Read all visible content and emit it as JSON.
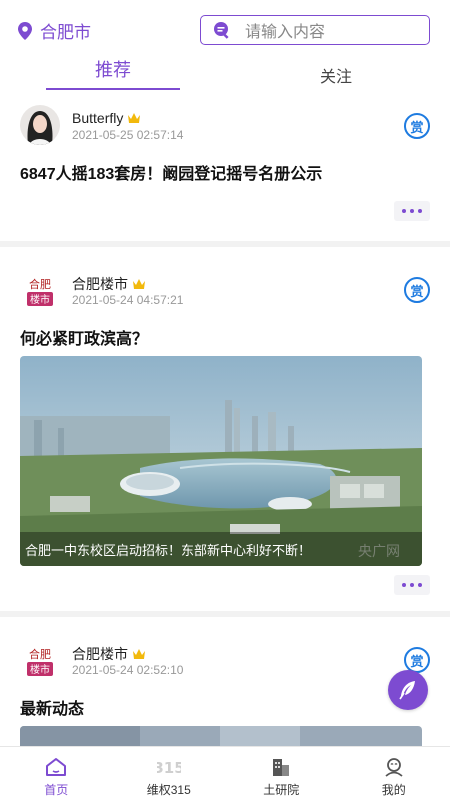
{
  "header": {
    "city": "合肥市",
    "search_placeholder": "请输入内容"
  },
  "tabs": [
    {
      "label": "推荐",
      "active": true
    },
    {
      "label": "关注",
      "active": false
    }
  ],
  "posts": [
    {
      "author": "Butterfly",
      "time": "2021-05-25 02:57:14",
      "title": "6847人摇183套房！阚园登记摇号名册公示",
      "reward": "赏"
    },
    {
      "author": "合肥楼市",
      "avatar_text": "合肥楼市",
      "time": "2021-05-24 04:57:21",
      "title": "何必紧盯政滨高？",
      "reward": "赏",
      "image_caption": "合肥一中东校区启动招标！东部新中心利好不断！",
      "watermark": "央广网"
    },
    {
      "author": "合肥楼市",
      "avatar_text": "合肥楼市",
      "time": "2021-05-24 02:52:10",
      "title": "最新动态",
      "reward": "赏"
    }
  ],
  "nav": [
    {
      "label": "首页",
      "icon": "home-icon",
      "active": true
    },
    {
      "label": "维权315",
      "icon": "315-icon",
      "active": false
    },
    {
      "label": "土研院",
      "icon": "building-icon",
      "active": false
    },
    {
      "label": "我的",
      "icon": "user-icon",
      "active": false
    }
  ],
  "colors": {
    "accent": "#7d4bd1",
    "reward": "#1e7be0",
    "crown": "#f2b90c"
  }
}
